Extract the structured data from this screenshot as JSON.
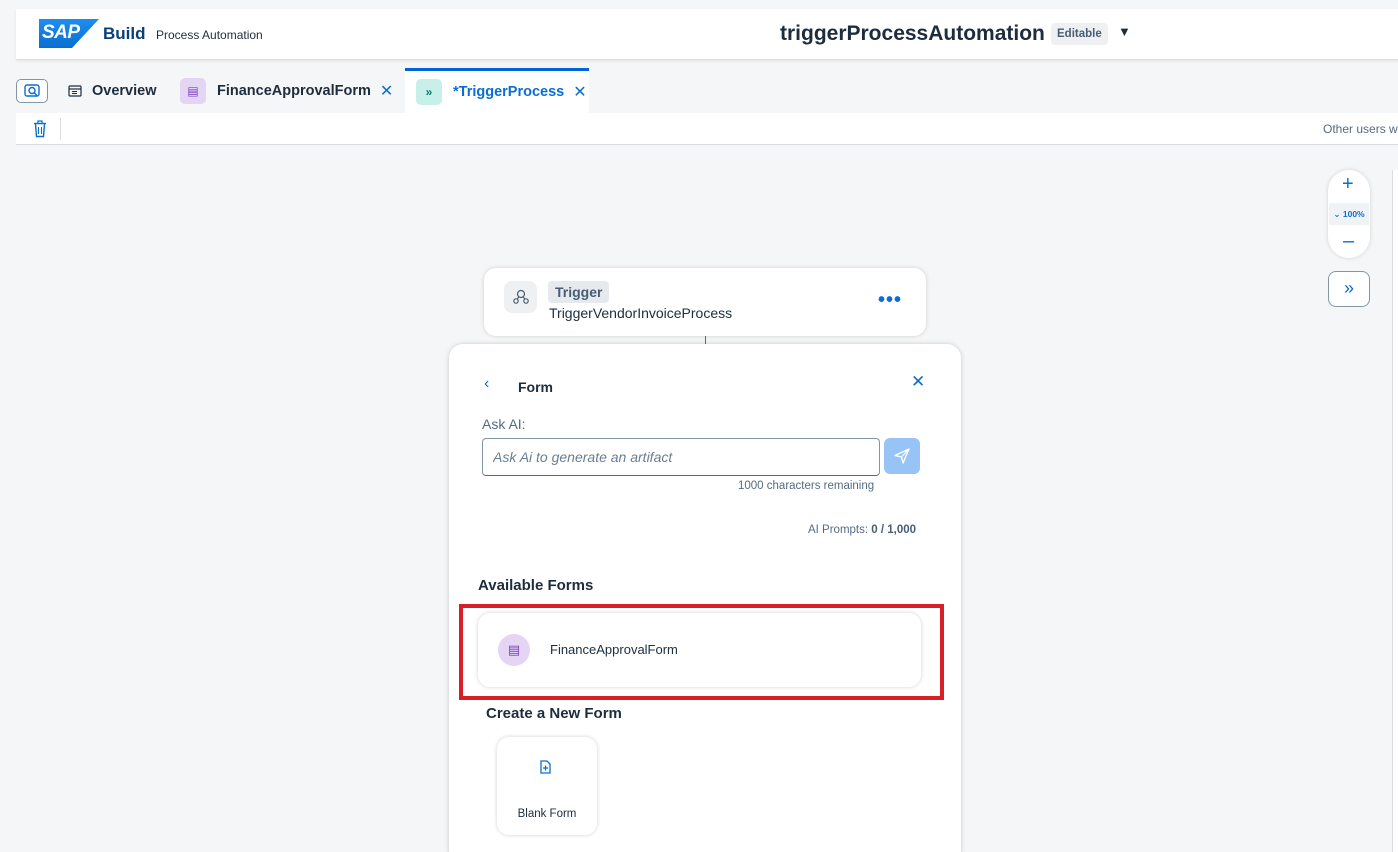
{
  "header": {
    "logo_text": "SAP",
    "brand": "Build",
    "product": "Process Automation",
    "project_title": "triggerProcessAutomation",
    "status_badge": "Editable"
  },
  "tabs": [
    {
      "label": "Overview"
    },
    {
      "label": "FinanceApprovalForm"
    },
    {
      "label": "*TriggerProcess",
      "active": true
    }
  ],
  "toolbar": {
    "other_users_text": "Other users w"
  },
  "zoom": {
    "level": "100%"
  },
  "trigger_card": {
    "tag": "Trigger",
    "name": "TriggerVendorInvoiceProcess"
  },
  "form_panel": {
    "title": "Form",
    "ask_label": "Ask AI:",
    "ask_placeholder": "Ask Ai to generate an artifact",
    "chars_remaining": "1000 characters remaining",
    "ai_prompts_label": "AI Prompts:",
    "ai_prompts_value": "0 / 1,000",
    "available_section": "Available Forms",
    "available_forms": [
      {
        "name": "FinanceApprovalForm"
      }
    ],
    "create_section": "Create a New Form",
    "blank_form_label": "Blank Form"
  },
  "colors": {
    "accent": "#0a6ed1",
    "highlight": "#d91f26",
    "form_icon_bg": "#e4d5f5",
    "trigger_icon_bg": "#c7f0ea"
  },
  "icons": {
    "search": "search-icon",
    "overview": "overview-icon",
    "form": "form-icon",
    "trigger": "trigger-icon",
    "close": "close-icon",
    "trash": "trash-icon",
    "zoom_in": "plus-icon",
    "zoom_out": "minus-icon",
    "expand": "double-chevron-right-icon",
    "more": "more-icon",
    "back": "chevron-left-icon",
    "send": "send-icon",
    "new_form": "add-document-icon"
  }
}
